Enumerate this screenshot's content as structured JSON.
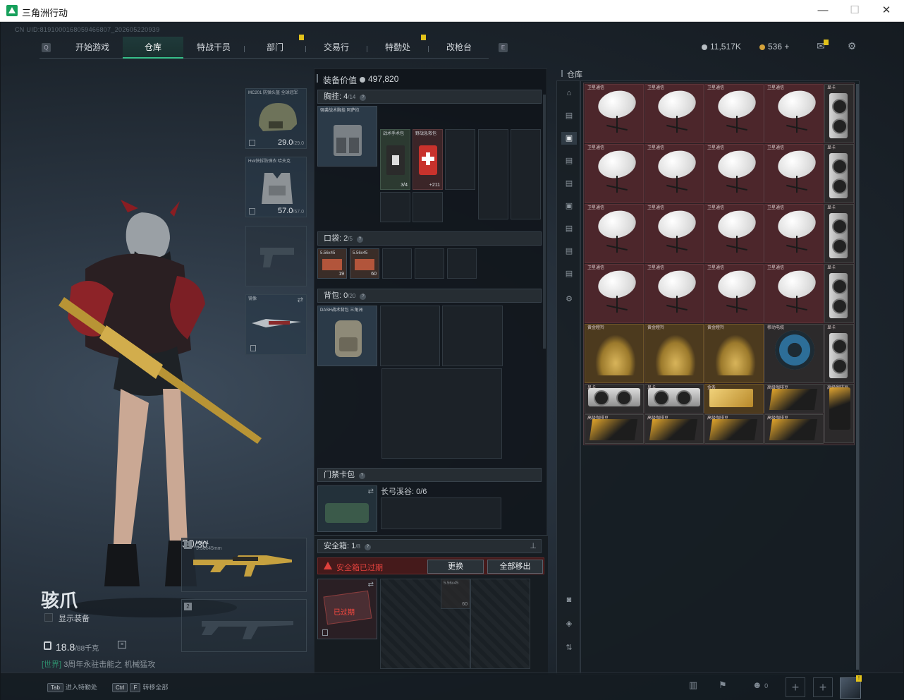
{
  "window": {
    "title": "三角洲行动",
    "controls": [
      "—",
      "☐",
      "✕"
    ]
  },
  "uid": "CN UID:8191000168059466807_202605220939",
  "nav": {
    "tabs": [
      "开始游戏",
      "仓库",
      "特战干员",
      "部门",
      "交易行",
      "特勤处",
      "改枪台"
    ],
    "active_tab": "仓库",
    "left_key": "Q",
    "right_key": "E"
  },
  "currency": {
    "silver": "11,517K",
    "gold": "536",
    "plus": "+"
  },
  "character": {
    "name": "骇爪",
    "show_equipment_label": "显示装备",
    "weight_value": "18.8",
    "weight_max": "/88千克",
    "chat_channel": "[世界]",
    "chat_text": "3周年永驻击能之 机械猛攻"
  },
  "gear": {
    "helmet": {
      "name": "MC201 防弹头盔 全球冠军",
      "durability": "29.0",
      "durability_max": "/29.0"
    },
    "armor": {
      "name": "Hvk快拆防弹衣 哈夫克",
      "durability": "57.0",
      "durability_max": "/57.0"
    },
    "melee": {
      "name": "镜像"
    },
    "primary": {
      "slot": "1",
      "name": "M4A1",
      "caliber": "5.56x45mm",
      "ammo": "30",
      "ammo_max": "/30"
    },
    "secondary": {
      "slot": "2"
    }
  },
  "loadout": {
    "value_label": "装备价值",
    "value": "497,820",
    "chest": {
      "label": "胸挂:",
      "count": "4",
      "capacity": "/14",
      "items": [
        {
          "name": "强袭战术胸挂 阿萨拉"
        },
        {
          "name": "战术手术包",
          "qty": "3/4"
        },
        {
          "name": "野战急救包",
          "qty": "+211"
        }
      ]
    },
    "pocket": {
      "label": "口袋:",
      "count": "2",
      "capacity": "/5",
      "items": [
        {
          "name": "5.56x45",
          "qty": "19"
        },
        {
          "name": "5.56x45",
          "qty": "60"
        }
      ]
    },
    "backpack": {
      "label": "背包:",
      "count": "0",
      "capacity": "/20",
      "item": "DASH战术背包 三角洲"
    },
    "keycard": {
      "label": "门禁卡包",
      "slot_label": "长弓溪谷: 0/6"
    },
    "safebox": {
      "label": "安全箱:",
      "count": "1",
      "capacity": "/8",
      "expired_warning": "安全箱已过期",
      "swap_btn": "更换",
      "move_all_btn": "全部移出",
      "expired_tag": "已过期",
      "item": {
        "name": "5.56x45",
        "qty": "60"
      }
    }
  },
  "warehouse": {
    "title": "仓库",
    "sat_label": "卫星通信",
    "items": [
      {
        "label": "卫星通信"
      },
      {
        "label": "卫星通信"
      },
      {
        "label": "卫星通信"
      },
      {
        "label": "卫星通信"
      },
      {
        "label": "显卡"
      },
      {
        "label": "卫星通信"
      },
      {
        "label": "卫星通信"
      },
      {
        "label": "卫星通信"
      },
      {
        "label": "卫星通信"
      },
      {
        "label": "显卡"
      },
      {
        "label": "卫星通信"
      },
      {
        "label": "卫星通信"
      },
      {
        "label": "卫星通信"
      },
      {
        "label": "卫星通信"
      },
      {
        "label": "显卡"
      },
      {
        "label": "卫星通信"
      },
      {
        "label": "卫星通信"
      },
      {
        "label": "卫星通信"
      },
      {
        "label": "卫星通信"
      },
      {
        "label": "显卡"
      },
      {
        "label": "黄金瞪羚"
      },
      {
        "label": "黄金瞪羚"
      },
      {
        "label": "黄金瞪羚"
      },
      {
        "label": "移动电缆"
      },
      {
        "label": "显卡"
      },
      {
        "label": "显卡"
      },
      {
        "label": "显卡"
      },
      {
        "label": "金条"
      },
      {
        "label": "高级咖啡豆"
      },
      {
        "label": "高级咖啡豆"
      },
      {
        "label": "高级咖啡豆"
      },
      {
        "label": "高级咖啡豆"
      },
      {
        "label": "高级咖啡豆"
      },
      {
        "label": "高级咖啡豆"
      }
    ]
  },
  "bottom": {
    "hint1_key": "Tab",
    "hint1_label": "进入特勤处",
    "hint2_key1": "Ctrl",
    "hint2_key2": "F",
    "hint2_label": "转移全部",
    "friends_count": "0",
    "avatar_badge": "!"
  }
}
